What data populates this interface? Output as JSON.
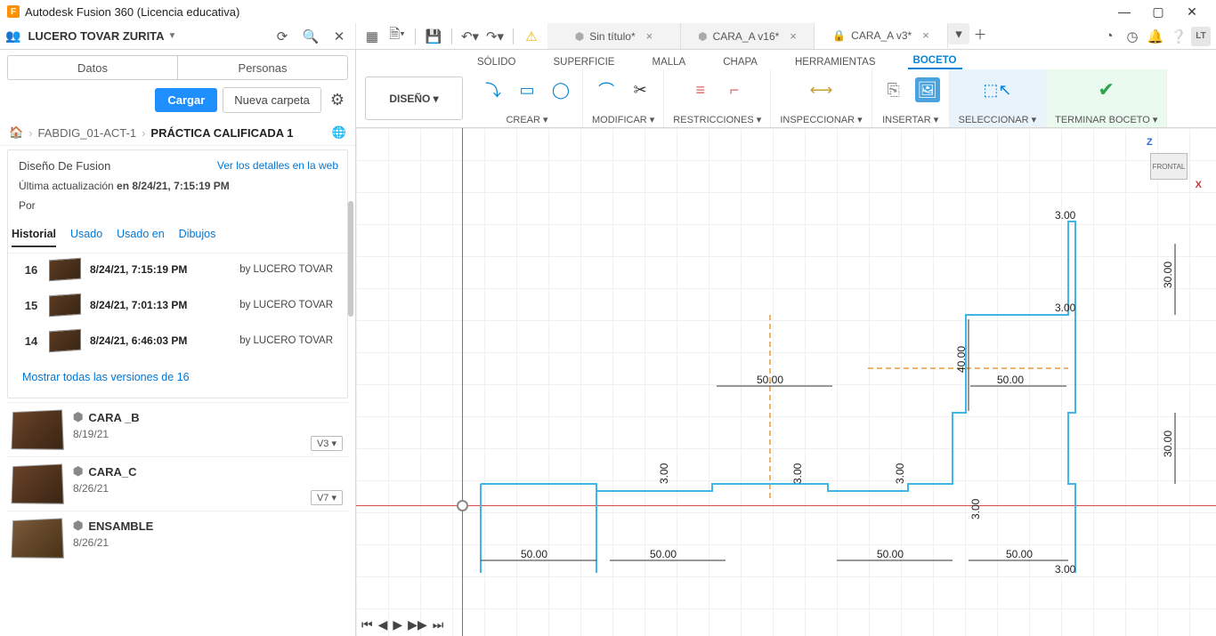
{
  "app": {
    "title": "Autodesk Fusion 360 (Licencia educativa)",
    "logo": "F"
  },
  "user": {
    "name": "LUCERO TOVAR ZURITA",
    "initials": "LT"
  },
  "windowControls": {
    "min": "—",
    "max": "▢",
    "close": "✕"
  },
  "docTabs": [
    {
      "label": "Sin título*",
      "active": false,
      "locked": false
    },
    {
      "label": "CARA_A v16*",
      "active": false,
      "locked": false
    },
    {
      "label": "CARA_A v3*",
      "active": true,
      "locked": true
    }
  ],
  "sidebar": {
    "tabs": {
      "data": "Datos",
      "people": "Personas"
    },
    "actions": {
      "upload": "Cargar",
      "newFolder": "Nueva carpeta"
    },
    "breadcrumb": {
      "a": "FABDIG_01-ACT-1",
      "b": "PRÁCTICA CALIFICADA 1"
    },
    "detail": {
      "title": "Diseño De Fusion",
      "link": "Ver los detalles en la web",
      "lastUpdatePrefix": "Última actualización ",
      "lastUpdateBold": "en 8/24/21, 7:15:19 PM",
      "by": "Por"
    },
    "versionTabs": {
      "history": "Historial",
      "used": "Usado",
      "usedIn": "Usado en",
      "drawings": "Dibujos"
    },
    "history": [
      {
        "num": "16",
        "time": "8/24/21, 7:15:19 PM",
        "by": "by LUCERO TOVAR"
      },
      {
        "num": "15",
        "time": "8/24/21, 7:01:13 PM",
        "by": "by LUCERO TOVAR"
      },
      {
        "num": "14",
        "time": "8/24/21, 6:46:03 PM",
        "by": "by LUCERO TOVAR"
      }
    ],
    "showAll": "Mostrar todas las versiones de 16",
    "files": [
      {
        "name": "CARA _B",
        "date": "8/19/21",
        "ver": "V3 ▾"
      },
      {
        "name": "CARA_C",
        "date": "8/26/21",
        "ver": "V7 ▾"
      },
      {
        "name": "ENSAMBLE",
        "date": "8/26/21",
        "ver": ""
      }
    ]
  },
  "ribbon": {
    "design": "DISEÑO ▾",
    "tabs": {
      "solid": "SÓLIDO",
      "surface": "SUPERFICIE",
      "mesh": "MALLA",
      "sheet": "CHAPA",
      "tools": "HERRAMIENTAS",
      "sketch": "BOCETO"
    },
    "groups": {
      "create": "CREAR ▾",
      "modify": "MODIFICAR ▾",
      "constraints": "RESTRICCIONES ▾",
      "inspect": "INSPECCIONAR ▾",
      "insert": "INSERTAR ▾",
      "select": "SELECCIONAR ▾",
      "finish": "TERMINAR BOCETO ▾"
    }
  },
  "viewcube": {
    "face": "FRONTAL",
    "z": "Z",
    "x": "X"
  },
  "dimensions": {
    "d50a": "50.00",
    "d50b": "50.00",
    "d50c": "50.00",
    "d50d": "50.00",
    "d50e": "50.00",
    "d50f": "50.00",
    "d3a": "3.00",
    "d3b": "3.00",
    "d3c": "3.00",
    "d3d": "3.00",
    "d3e": "3.00",
    "d3f": "3.00",
    "d3g": "3.00",
    "d30a": "30.00",
    "d30b": "30.00",
    "d40": "40.00"
  }
}
